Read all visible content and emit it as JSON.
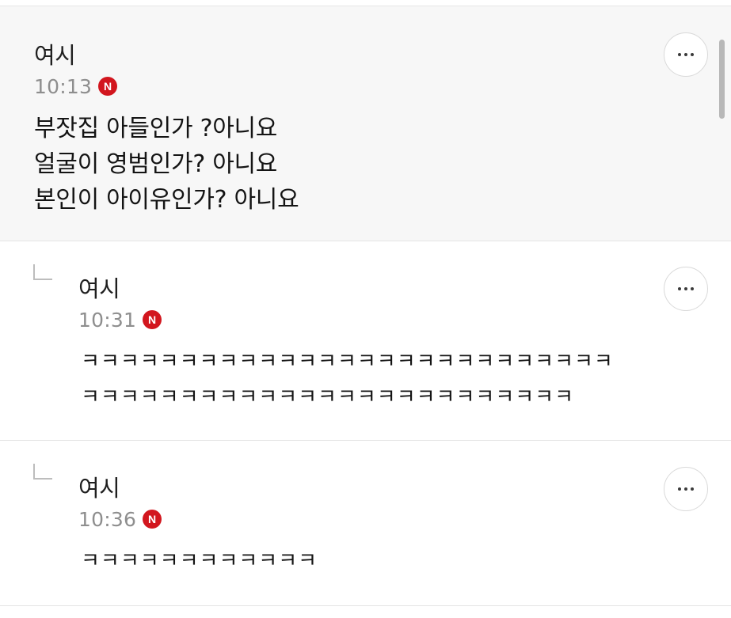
{
  "comments": [
    {
      "author": "여시",
      "time": "10:13",
      "badge": "N",
      "lines": [
        "부잣집 아들인가 ?아니요",
        "얼굴이 영범인가? 아니요",
        "본인이 아이유인가? 아니요"
      ]
    },
    {
      "author": "여시",
      "time": "10:31",
      "badge": "N",
      "lines": [
        "ㅋㅋㅋㅋㅋㅋㅋㅋㅋㅋㅋㅋㅋㅋㅋㅋㅋㅋㅋㅋㅋㅋㅋㅋㅋㅋㅋ",
        "ㅋㅋㅋㅋㅋㅋㅋㅋㅋㅋㅋㅋㅋㅋㅋㅋㅋㅋㅋㅋㅋㅋㅋㅋㅋ"
      ]
    },
    {
      "author": "여시",
      "time": "10:36",
      "badge": "N",
      "lines": [
        "ㅋㅋㅋㅋㅋㅋㅋㅋㅋㅋㅋㅋ"
      ]
    }
  ],
  "colors": {
    "badge": "#d2161e",
    "time": "#8e8e8e",
    "main_comment_bg": "#f7f7f7"
  },
  "icons": {
    "more": "more-horizontal-icon",
    "reply": "reply-arrow-icon"
  }
}
